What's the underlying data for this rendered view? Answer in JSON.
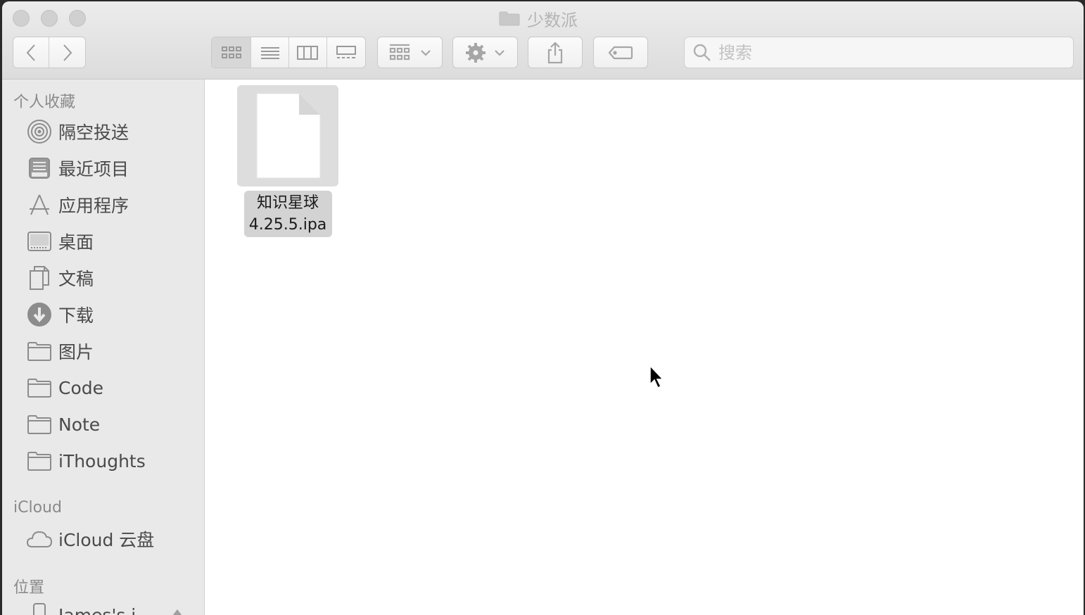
{
  "window": {
    "title": "少数派"
  },
  "toolbar": {
    "back_icon": "chevron-left-icon",
    "forward_icon": "chevron-right-icon",
    "view_modes": [
      "icon-view-icon",
      "list-view-icon",
      "column-view-icon",
      "gallery-view-icon"
    ],
    "active_view": "icon-view-icon",
    "group_icon": "group-by-icon",
    "action_icon": "gear-icon",
    "share_icon": "share-icon",
    "tag_icon": "tag-icon",
    "search_placeholder": "搜索"
  },
  "sidebar": {
    "favorites_title": "个人收藏",
    "favorites": [
      {
        "label": "隔空投送",
        "icon": "airdrop-icon"
      },
      {
        "label": "最近项目",
        "icon": "recents-icon"
      },
      {
        "label": "应用程序",
        "icon": "applications-icon"
      },
      {
        "label": "桌面",
        "icon": "desktop-icon"
      },
      {
        "label": "文稿",
        "icon": "documents-icon"
      },
      {
        "label": "下载",
        "icon": "downloads-icon"
      },
      {
        "label": "图片",
        "icon": "folder-icon"
      },
      {
        "label": "Code",
        "icon": "folder-icon"
      },
      {
        "label": "Note",
        "icon": "folder-icon"
      },
      {
        "label": "iThoughts",
        "icon": "folder-icon"
      }
    ],
    "icloud_title": "iCloud",
    "icloud": [
      {
        "label": "iCloud 云盘",
        "icon": "cloud-icon"
      }
    ],
    "locations_title": "位置",
    "locations": [
      {
        "label": "James's i",
        "icon": "phone-icon"
      }
    ]
  },
  "files": [
    {
      "name_line1": "知识星球",
      "name_line2": "4.25.5.ipa",
      "icon": "document-icon",
      "selected": true
    }
  ]
}
